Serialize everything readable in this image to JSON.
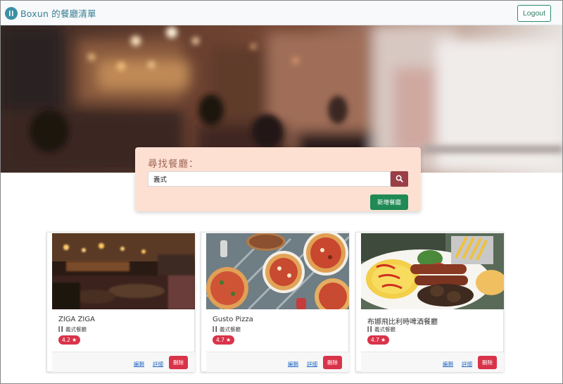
{
  "navbar": {
    "brand_text": "Boxun 的餐廳清單",
    "logout_label": "Logout"
  },
  "search": {
    "title": "尋找餐廳：",
    "input_value": "義式",
    "new_label": "新增餐廳"
  },
  "restaurants": [
    {
      "name": "ZIGA ZIGA",
      "category": "義式餐廳",
      "rating": "4.2",
      "edit_label": "編輯",
      "detail_label": "詳細",
      "delete_label": "刪除"
    },
    {
      "name": "Gusto Pizza",
      "category": "義式餐廳",
      "rating": "4.7",
      "edit_label": "編輯",
      "detail_label": "詳細",
      "delete_label": "刪除"
    },
    {
      "name": "布娜飛比利時啤酒餐廳",
      "category": "義式餐廳",
      "rating": "4.7",
      "edit_label": "編輯",
      "detail_label": "詳細",
      "delete_label": "刪除"
    }
  ],
  "icons": {
    "brand": "utensils-icon",
    "search": "search-icon",
    "category": "fork-knife-icon",
    "rating": "star-icon"
  },
  "colors": {
    "brand": "#3a7f95",
    "logout_border": "#2e8b6e",
    "search_panel": "#fde0d2",
    "search_button": "#9a3e47",
    "new_button": "#1f8a55",
    "danger": "#d9334a",
    "link": "#2b6ec7"
  }
}
